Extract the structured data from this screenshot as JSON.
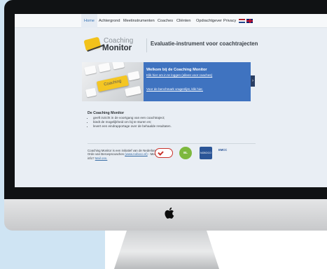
{
  "nav": {
    "items": [
      "Home",
      "Achtergrond",
      "Meetinstrumenten",
      "Coaches",
      "Cliënten",
      "Opdrachtgever",
      "Privacy"
    ],
    "active": "Home",
    "languages": [
      "nl",
      "en"
    ]
  },
  "brand": {
    "name_line1": "Coaching",
    "name_line2": "Monitor",
    "tagline": "Evaluatie-instrument voor coachtrajecten",
    "accent_color": "#f2c21a"
  },
  "banner": {
    "image_label": "Coaching",
    "title": "Welkom bij de Coaching Monitor",
    "login_link": "Klik hier om in te loggen (alleen voor coaches)",
    "benchmark_link": "Voor de benchmark vragenlijst, klik hier.",
    "arrow": "›",
    "panel_color": "#3f73c0"
  },
  "section": {
    "title": "De Coaching Monitor",
    "bullets": [
      "geeft inzicht in de voortgang van een coachtraject;",
      "biedt de mogelijkheid om bij te sturen en;",
      "levert een eindrapportage over de behaalde resultaten."
    ]
  },
  "footer": {
    "text": "Coaching Monitor is een initiatief van de Nederlandse Orde van Beroepscoaches",
    "site_link": "(www.noboco.nl)",
    "contact_prefix": " - Meer info? ",
    "contact_link": "Mail ons."
  },
  "partners": {
    "logos": [
      "checkmark-seal-icon",
      "bl-circle-logo",
      "noboco-shield-logo",
      "emcc-logo"
    ],
    "p2_label": "BL",
    "p3_label": "NOBOCO",
    "p4_label": "EMCC"
  }
}
